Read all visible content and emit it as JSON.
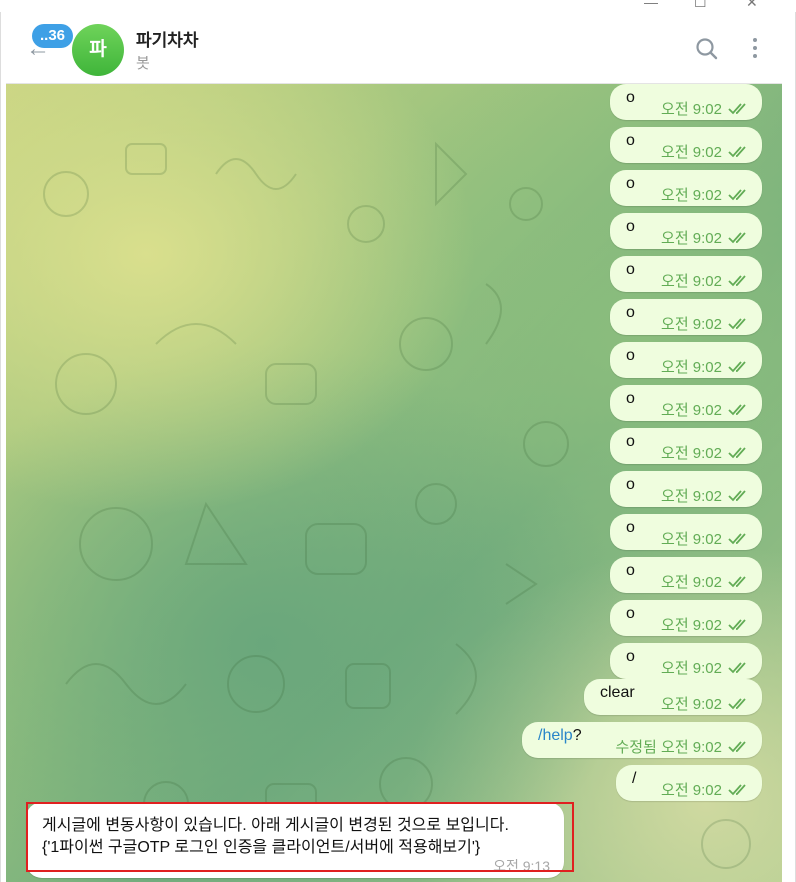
{
  "window": {
    "minimize_glyph": "—",
    "maximize_glyph": "☐",
    "close_glyph": "✕"
  },
  "header": {
    "back_icon": "←",
    "unread_count": "..36",
    "avatar_letter": "파",
    "title": "파기차차",
    "status": "봇",
    "avatar_color": "#4cc043"
  },
  "messages": [
    {
      "text": "o",
      "time": "오전 9:02",
      "edited": ""
    },
    {
      "text": "o",
      "time": "오전 9:02",
      "edited": ""
    },
    {
      "text": "o",
      "time": "오전 9:02",
      "edited": ""
    },
    {
      "text": "o",
      "time": "오전 9:02",
      "edited": ""
    },
    {
      "text": "o",
      "time": "오전 9:02",
      "edited": ""
    },
    {
      "text": "o",
      "time": "오전 9:02",
      "edited": ""
    },
    {
      "text": "o",
      "time": "오전 9:02",
      "edited": ""
    },
    {
      "text": "o",
      "time": "오전 9:02",
      "edited": ""
    },
    {
      "text": "o",
      "time": "오전 9:02",
      "edited": ""
    },
    {
      "text": "o",
      "time": "오전 9:02",
      "edited": ""
    },
    {
      "text": "o",
      "time": "오전 9:02",
      "edited": ""
    },
    {
      "text": "o",
      "time": "오전 9:02",
      "edited": ""
    },
    {
      "text": "o",
      "time": "오전 9:02",
      "edited": ""
    },
    {
      "text": "o",
      "time": "오전 9:02",
      "edited": ""
    },
    {
      "text": "clear",
      "time": "오전 9:02",
      "edited": ""
    },
    {
      "link": "/help",
      "suffix": "?",
      "time": "오전 9:02",
      "edited": "수정됨"
    },
    {
      "text": "/",
      "time": "오전 9:02",
      "edited": ""
    }
  ],
  "incoming": {
    "line1": "게시글에 변동사항이 있습니다. 아래 게시글이 변경된 것으로 보입니다.",
    "line2": "{'1파이썬 구글OTP 로그인 인증을 클라이언트/서버에 적용해보기'}",
    "time": "오전 9:13"
  },
  "colors": {
    "outgoing_bubble": "#effdde",
    "outgoing_meta": "#62ac55",
    "link": "#2a86c9",
    "highlight": "#e02020"
  }
}
